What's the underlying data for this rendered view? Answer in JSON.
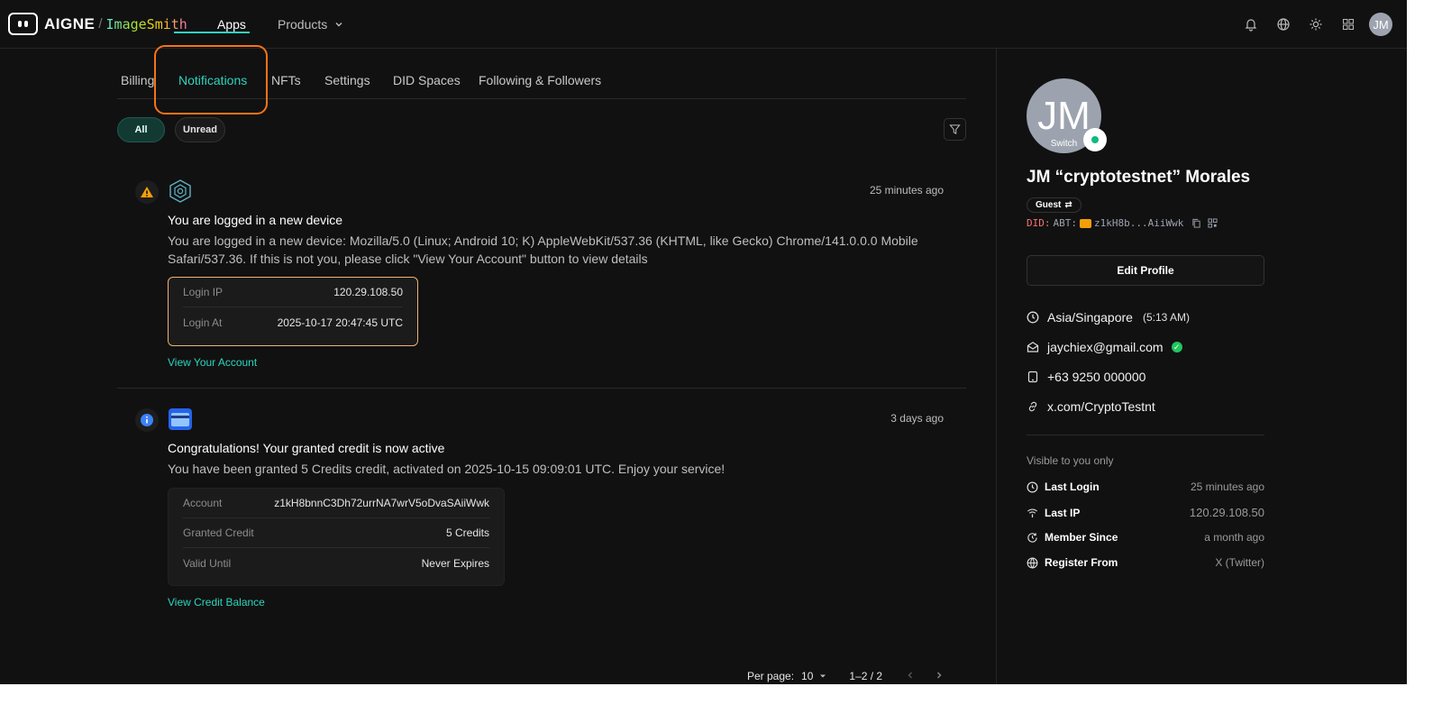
{
  "header": {
    "brand": "AIGNE",
    "product": "ImageSmith",
    "nav": {
      "apps": "Apps",
      "products": "Products"
    },
    "avatar_initials": "JM"
  },
  "tabs": [
    {
      "label": "Billing"
    },
    {
      "label": "Notifications",
      "active": true
    },
    {
      "label": "NFTs"
    },
    {
      "label": "Settings"
    },
    {
      "label": "DID Spaces"
    },
    {
      "label": "Following & Followers"
    }
  ],
  "filters": {
    "all": "All",
    "unread": "Unread"
  },
  "notifications": [
    {
      "severity": "warning",
      "time": "25 minutes ago",
      "title": "You are logged in a new device",
      "body": "You are logged in a new device: Mozilla/5.0 (Linux; Android 10; K) AppleWebKit/537.36 (KHTML, like Gecko) Chrome/141.0.0.0 Mobile Safari/537.36. If this is not you, please click \"View Your Account\" button to view details",
      "rows": [
        {
          "key": "Login IP",
          "value": "120.29.108.50"
        },
        {
          "key": "Login At",
          "value": "2025-10-17 20:47:45 UTC"
        }
      ],
      "link": "View Your Account"
    },
    {
      "severity": "info",
      "time": "3 days ago",
      "title": "Congratulations! Your granted credit is now active",
      "body": "You have been granted 5 Credits credit, activated on 2025-10-15 09:09:01 UTC. Enjoy your service!",
      "rows": [
        {
          "key": "Account",
          "value": "z1kH8bnnC3Dh72urrNA7wrV5oDvaSAiiWwk"
        },
        {
          "key": "Granted Credit",
          "value": "5 Credits"
        },
        {
          "key": "Valid Until",
          "value": "Never Expires"
        }
      ],
      "link": "View Credit Balance"
    }
  ],
  "pagination": {
    "per_page_label": "Per page:",
    "per_page": "10",
    "range": "1–2 / 2"
  },
  "profile": {
    "initials": "JM",
    "switch": "Switch",
    "name": "JM “cryptotestnet” Morales",
    "role": "Guest",
    "did_prefix": "DID:",
    "did_type": "ABT:",
    "did_short": "z1kH8b...AiiWwk",
    "edit_button": "Edit Profile",
    "timezone": "Asia/Singapore",
    "local_time": "(5:13 AM)",
    "email": "jaychiex@gmail.com",
    "phone": "+63 9250 000000",
    "link": "x.com/CryptoTestnt",
    "visible_note": "Visible to you only",
    "stats": [
      {
        "label": "Last Login",
        "value": "25 minutes ago"
      },
      {
        "label": "Last IP",
        "value": "120.29.108.50"
      },
      {
        "label": "Member Since",
        "value": "a month ago"
      },
      {
        "label": "Register From",
        "value": "X (Twitter)"
      }
    ]
  },
  "colors": {
    "accent": "#2dd4bf",
    "highlight": "#f97316",
    "warning": "#f59e0b",
    "info": "#3b82f6"
  }
}
